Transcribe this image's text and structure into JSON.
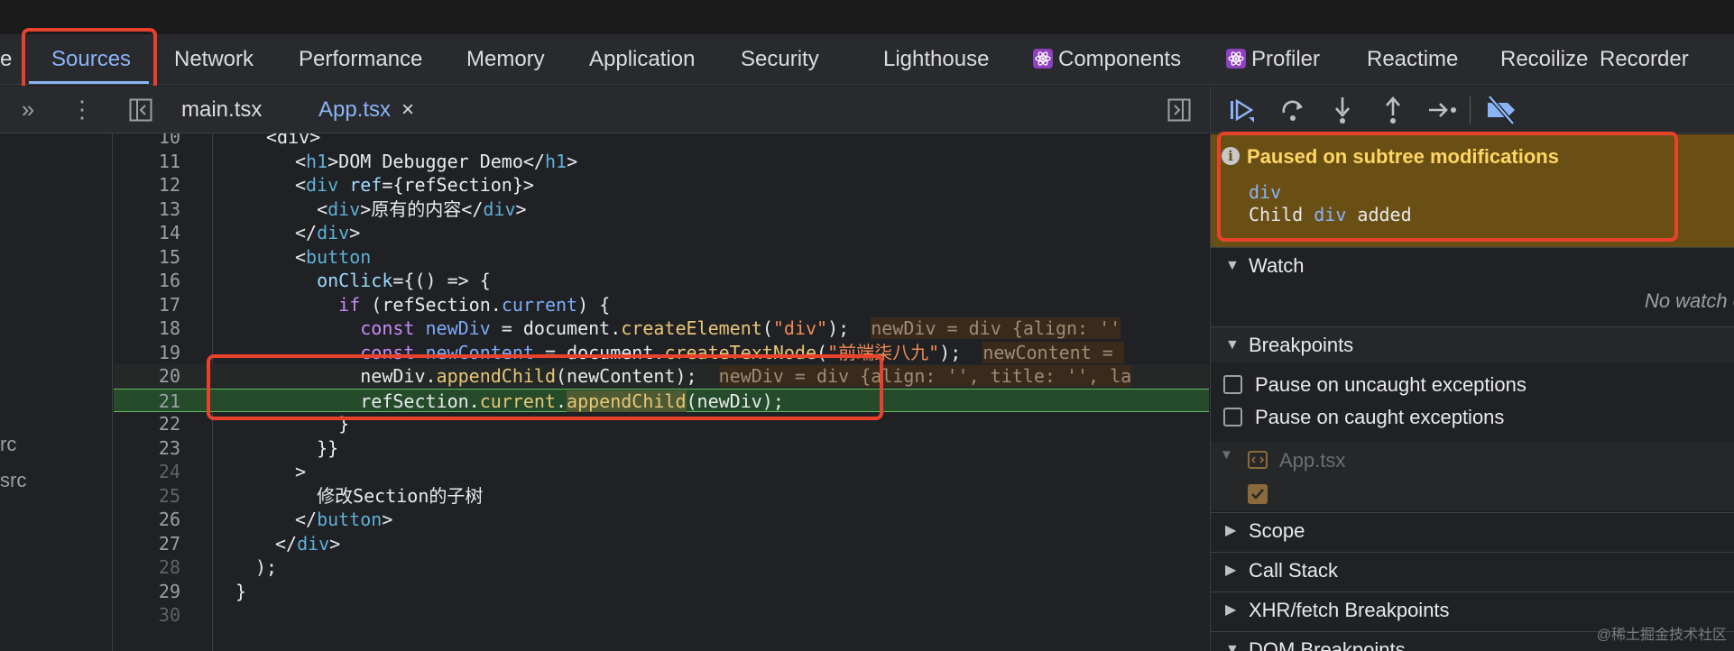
{
  "devtools": {
    "tabs": [
      {
        "label": "e"
      },
      {
        "label": "Sources"
      },
      {
        "label": "Network"
      },
      {
        "label": "Performance"
      },
      {
        "label": "Memory"
      },
      {
        "label": "Application"
      },
      {
        "label": "Security"
      },
      {
        "label": "Lighthouse"
      },
      {
        "label": "Components"
      },
      {
        "label": "Profiler"
      },
      {
        "label": "Reactime"
      },
      {
        "label": "Recoilize"
      },
      {
        "label": "Recorder"
      }
    ],
    "active_tab": "Sources"
  },
  "editor": {
    "files": [
      {
        "label": "main.tsx"
      },
      {
        "label": "App.tsx"
      }
    ],
    "close_icon": "×",
    "navigator_items": [
      "rc",
      "src"
    ]
  },
  "code": {
    "lines": [
      {
        "n": "10",
        "segs": []
      },
      {
        "n": "11",
        "segs": [
          [
            "txt",
            "<"
          ],
          [
            "tag",
            "h1"
          ],
          [
            "txt",
            ">DOM Debugger Demo</"
          ],
          [
            "tag",
            "h1"
          ],
          [
            "txt",
            ">"
          ]
        ]
      },
      {
        "n": "12",
        "segs": [
          [
            "txt",
            "<"
          ],
          [
            "tag",
            "div"
          ],
          [
            "txt",
            " "
          ],
          [
            "attr",
            "ref"
          ],
          [
            "txt",
            "={refSection}>"
          ]
        ]
      },
      {
        "n": "13",
        "segs": [
          [
            "txt",
            "  <"
          ],
          [
            "tag",
            "div"
          ],
          [
            "txt",
            ">原有的内容</"
          ],
          [
            "tag",
            "div"
          ],
          [
            "txt",
            ">"
          ]
        ]
      },
      {
        "n": "14",
        "segs": [
          [
            "txt",
            "</"
          ],
          [
            "tag",
            "div"
          ],
          [
            "txt",
            ">"
          ]
        ]
      },
      {
        "n": "15",
        "segs": [
          [
            "txt",
            "<"
          ],
          [
            "tag",
            "button"
          ]
        ]
      },
      {
        "n": "16",
        "segs": [
          [
            "txt",
            "  "
          ],
          [
            "attr",
            "onClick"
          ],
          [
            "txt",
            "={() => {"
          ]
        ]
      },
      {
        "n": "17",
        "segs": [
          [
            "txt",
            "    "
          ],
          [
            "kw",
            "if"
          ],
          [
            "txt",
            " (refSection."
          ],
          [
            "prop",
            "current"
          ],
          [
            "txt",
            ") {"
          ]
        ]
      },
      {
        "n": "18",
        "segs": [
          [
            "txt",
            "      "
          ],
          [
            "kw",
            "const"
          ],
          [
            "txt",
            " "
          ],
          [
            "prop",
            "newDiv"
          ],
          [
            "txt",
            " = document."
          ],
          [
            "fn",
            "createElement"
          ],
          [
            "txt",
            "("
          ],
          [
            "str",
            "\"div\""
          ],
          [
            "txt",
            ");  "
          ],
          [
            "val",
            "newDiv = div {align: ''"
          ]
        ]
      },
      {
        "n": "19",
        "segs": [
          [
            "txt",
            "      "
          ],
          [
            "kw",
            "const"
          ],
          [
            "txt",
            " "
          ],
          [
            "prop",
            "newContent"
          ],
          [
            "txt",
            " = document."
          ],
          [
            "fn",
            "createTextNode"
          ],
          [
            "txt",
            "("
          ],
          [
            "str",
            "\"前端柒八九\""
          ],
          [
            "txt",
            ");  "
          ],
          [
            "val",
            "newContent = "
          ]
        ]
      },
      {
        "n": "20",
        "segs": [
          [
            "txt",
            "      newDiv."
          ],
          [
            "fn",
            "appendChild"
          ],
          [
            "txt",
            "(newContent);  "
          ],
          [
            "val",
            "newDiv = div {align: '', title: '', la"
          ]
        ]
      },
      {
        "n": "21",
        "segs": [
          [
            "txt",
            "      refSection."
          ],
          [
            "fn",
            "current"
          ],
          [
            "txt",
            "."
          ],
          [
            "fnhl",
            "appendChild"
          ],
          [
            "txt",
            "(newDiv);"
          ]
        ]
      },
      {
        "n": "22",
        "segs": [
          [
            "txt",
            "    }"
          ]
        ]
      },
      {
        "n": "23",
        "segs": [
          [
            "txt",
            "  }}"
          ]
        ]
      },
      {
        "n": "24",
        "segs": [
          [
            "txt",
            ">"
          ]
        ]
      },
      {
        "n": "25",
        "segs": [
          [
            "txt",
            "  修改Section的子树"
          ]
        ]
      },
      {
        "n": "26",
        "segs": [
          [
            "txt",
            "</"
          ],
          [
            "tag",
            "button"
          ],
          [
            "txt",
            ">"
          ]
        ]
      },
      {
        "n": "27",
        "segs": [
          [
            "txt",
            "</"
          ],
          [
            "tag",
            "div"
          ],
          [
            "txt",
            ">"
          ]
        ]
      },
      {
        "n": "28",
        "segs": [
          [
            "txt",
            ");"
          ]
        ]
      },
      {
        "n": "29",
        "segs": [
          [
            "txt",
            "}"
          ]
        ]
      },
      {
        "n": "30",
        "segs": []
      }
    ],
    "top_partial": "<div>"
  },
  "debugger": {
    "paused_title": "Paused on subtree modifications",
    "paused_node": "div",
    "paused_detail_prefix": "Child ",
    "paused_detail_tag": "div",
    "paused_detail_suffix": " added",
    "watch_label": "Watch",
    "no_watch": "No watch e",
    "breakpoints_label": "Breakpoints",
    "uncaught_label": "Pause on uncaught exceptions",
    "caught_label": "Pause on caught exceptions",
    "bp_file": "App.tsx",
    "scope_label": "Scope",
    "call_stack_label": "Call Stack",
    "xhr_label": "XHR/fetch Breakpoints",
    "dom_label": "DOM Breakpoints"
  },
  "watermark": "@稀土掘金技术社区",
  "colors": {
    "accent": "#8ab4f8",
    "highlight_box": "#e8412c",
    "paused_bg": "#6a4f14"
  }
}
